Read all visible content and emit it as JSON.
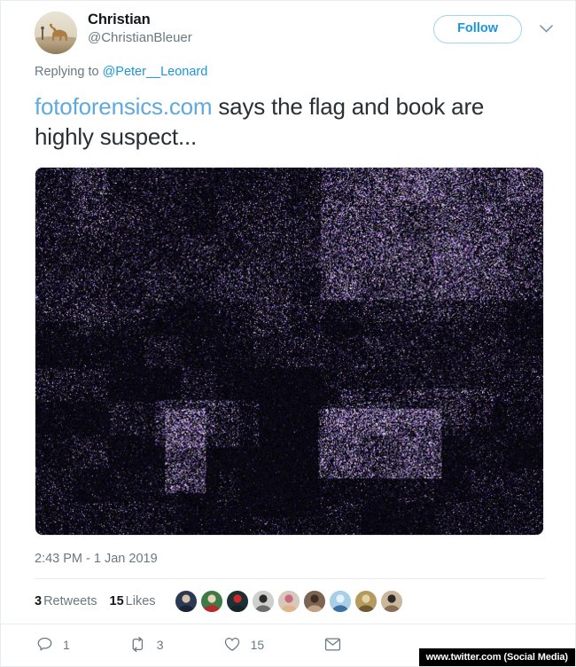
{
  "tweet": {
    "author": {
      "display_name": "Christian",
      "handle": "@ChristianBleuer",
      "avatar_icon": "camel-desert-avatar"
    },
    "follow_button": "Follow",
    "more_menu_icon": "chevron-down-icon",
    "reply_context_prefix": "Replying to ",
    "reply_context_mention": "@Peter__Leonard",
    "text_link": "fotoforensics.com",
    "text_rest": " says the flag and book are highly suspect...",
    "media": {
      "name": "error-level-analysis-image",
      "alt": "Error level analysis noise image of a dark interior scene with bright suspect regions"
    },
    "timestamp": "2:43 PM - 1 Jan 2019",
    "stats": {
      "retweets_count": "3",
      "retweets_label": "Retweets",
      "likes_count": "15",
      "likes_label": "Likes"
    },
    "facepile": [
      {
        "name": "liker-avatar-1",
        "colors": [
          "#2b3a52",
          "#d8c2a8",
          "#1b2435"
        ]
      },
      {
        "name": "liker-avatar-2",
        "colors": [
          "#3e7a46",
          "#e8d2bb",
          "#b9282c"
        ]
      },
      {
        "name": "liker-avatar-3",
        "colors": [
          "#1d3033",
          "#cf2a2a",
          "#16242a"
        ]
      },
      {
        "name": "liker-avatar-4",
        "colors": [
          "#cfcfcd",
          "#2b2b2b",
          "#6d6d6d"
        ]
      },
      {
        "name": "liker-avatar-5",
        "colors": [
          "#d8c8bc",
          "#c96a80",
          "#e2b48a"
        ]
      },
      {
        "name": "liker-avatar-6",
        "colors": [
          "#7d6450",
          "#3d2f25",
          "#c4a183"
        ]
      },
      {
        "name": "liker-avatar-7",
        "colors": [
          "#a8cfe8",
          "#e8f2f8",
          "#3d6fa0"
        ]
      },
      {
        "name": "liker-avatar-8",
        "colors": [
          "#b59a5e",
          "#e3d2a8",
          "#6d5a33"
        ]
      },
      {
        "name": "liker-avatar-9",
        "colors": [
          "#cdb79c",
          "#2a2a2a",
          "#8a6d52"
        ]
      }
    ],
    "actions": [
      {
        "name": "reply-action",
        "icon": "reply-icon",
        "count": "1"
      },
      {
        "name": "retweet-action",
        "icon": "retweet-icon",
        "count": "3"
      },
      {
        "name": "like-action",
        "icon": "heart-icon",
        "count": "15"
      },
      {
        "name": "direct-message-action",
        "icon": "envelope-icon",
        "count": ""
      }
    ]
  },
  "watermark": "www.twitter.com (Social Media)",
  "colors": {
    "accent": "#1b95e0",
    "link": "#5fa9dd",
    "muted": "#697882",
    "text": "#292f33",
    "border": "#e6ecf0"
  }
}
